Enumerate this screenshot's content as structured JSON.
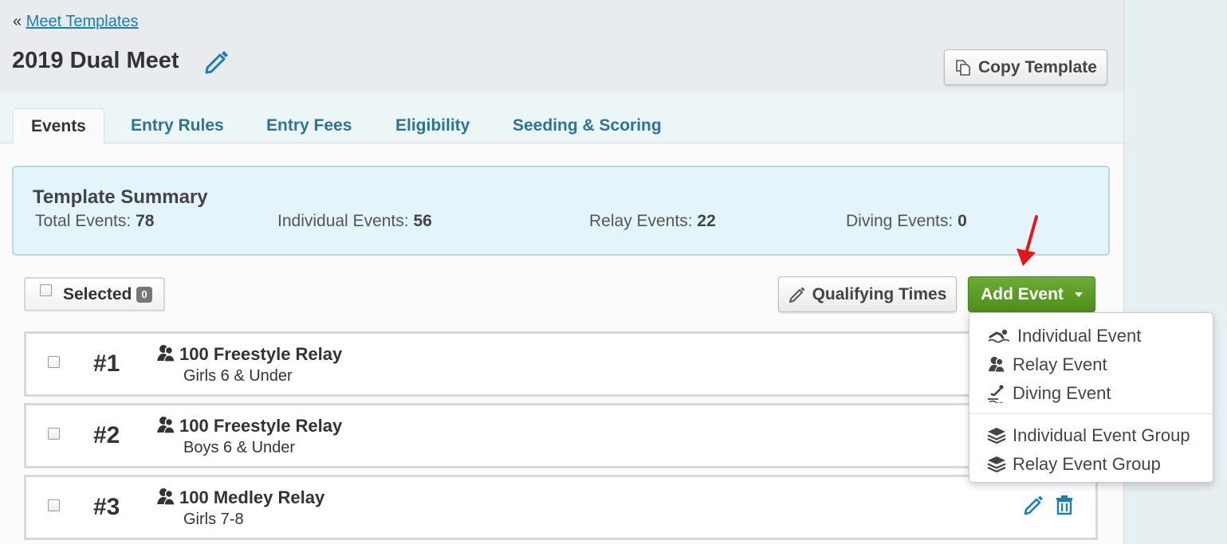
{
  "breadcrumb": {
    "prefix": "«",
    "link": "Meet Templates"
  },
  "page_title": "2019 Dual Meet",
  "buttons": {
    "copy_template": "Copy Template",
    "qualifying_times": "Qualifying Times",
    "add_event": "Add Event"
  },
  "tabs": [
    {
      "label": "Events",
      "active": true
    },
    {
      "label": "Entry Rules"
    },
    {
      "label": "Entry Fees"
    },
    {
      "label": "Eligibility"
    },
    {
      "label": "Seeding & Scoring"
    }
  ],
  "summary": {
    "heading": "Template Summary",
    "stats": [
      {
        "label": "Total Events:",
        "value": "78"
      },
      {
        "label": "Individual Events:",
        "value": "56"
      },
      {
        "label": "Relay Events:",
        "value": "22"
      },
      {
        "label": "Diving Events:",
        "value": "0"
      }
    ]
  },
  "selection": {
    "label": "Selected",
    "count": "0"
  },
  "events": [
    {
      "number": "#1",
      "name": "100 Freestyle Relay",
      "group": "Girls 6 & Under",
      "icon": "relay-icon"
    },
    {
      "number": "#2",
      "name": "100 Freestyle Relay",
      "group": "Boys 6 & Under",
      "icon": "relay-icon"
    },
    {
      "number": "#3",
      "name": "100 Medley Relay",
      "group": "Girls 7-8",
      "icon": "relay-icon"
    }
  ],
  "add_event_menu": [
    {
      "label": "Individual Event",
      "icon": "swimmer-icon"
    },
    {
      "label": "Relay Event",
      "icon": "relay-icon"
    },
    {
      "label": "Diving Event",
      "icon": "diver-icon"
    },
    {
      "label": "Individual Event Group",
      "icon": "layers-icon"
    },
    {
      "label": "Relay Event Group",
      "icon": "layers-icon"
    }
  ],
  "colors": {
    "link": "#1a7fb5",
    "tab_text": "#2b7494",
    "add_button": "#5a9a26",
    "summary_bg": "#e4f4fb",
    "action_icon": "#1a7fb5",
    "annotation_arrow": "#e8141a"
  }
}
